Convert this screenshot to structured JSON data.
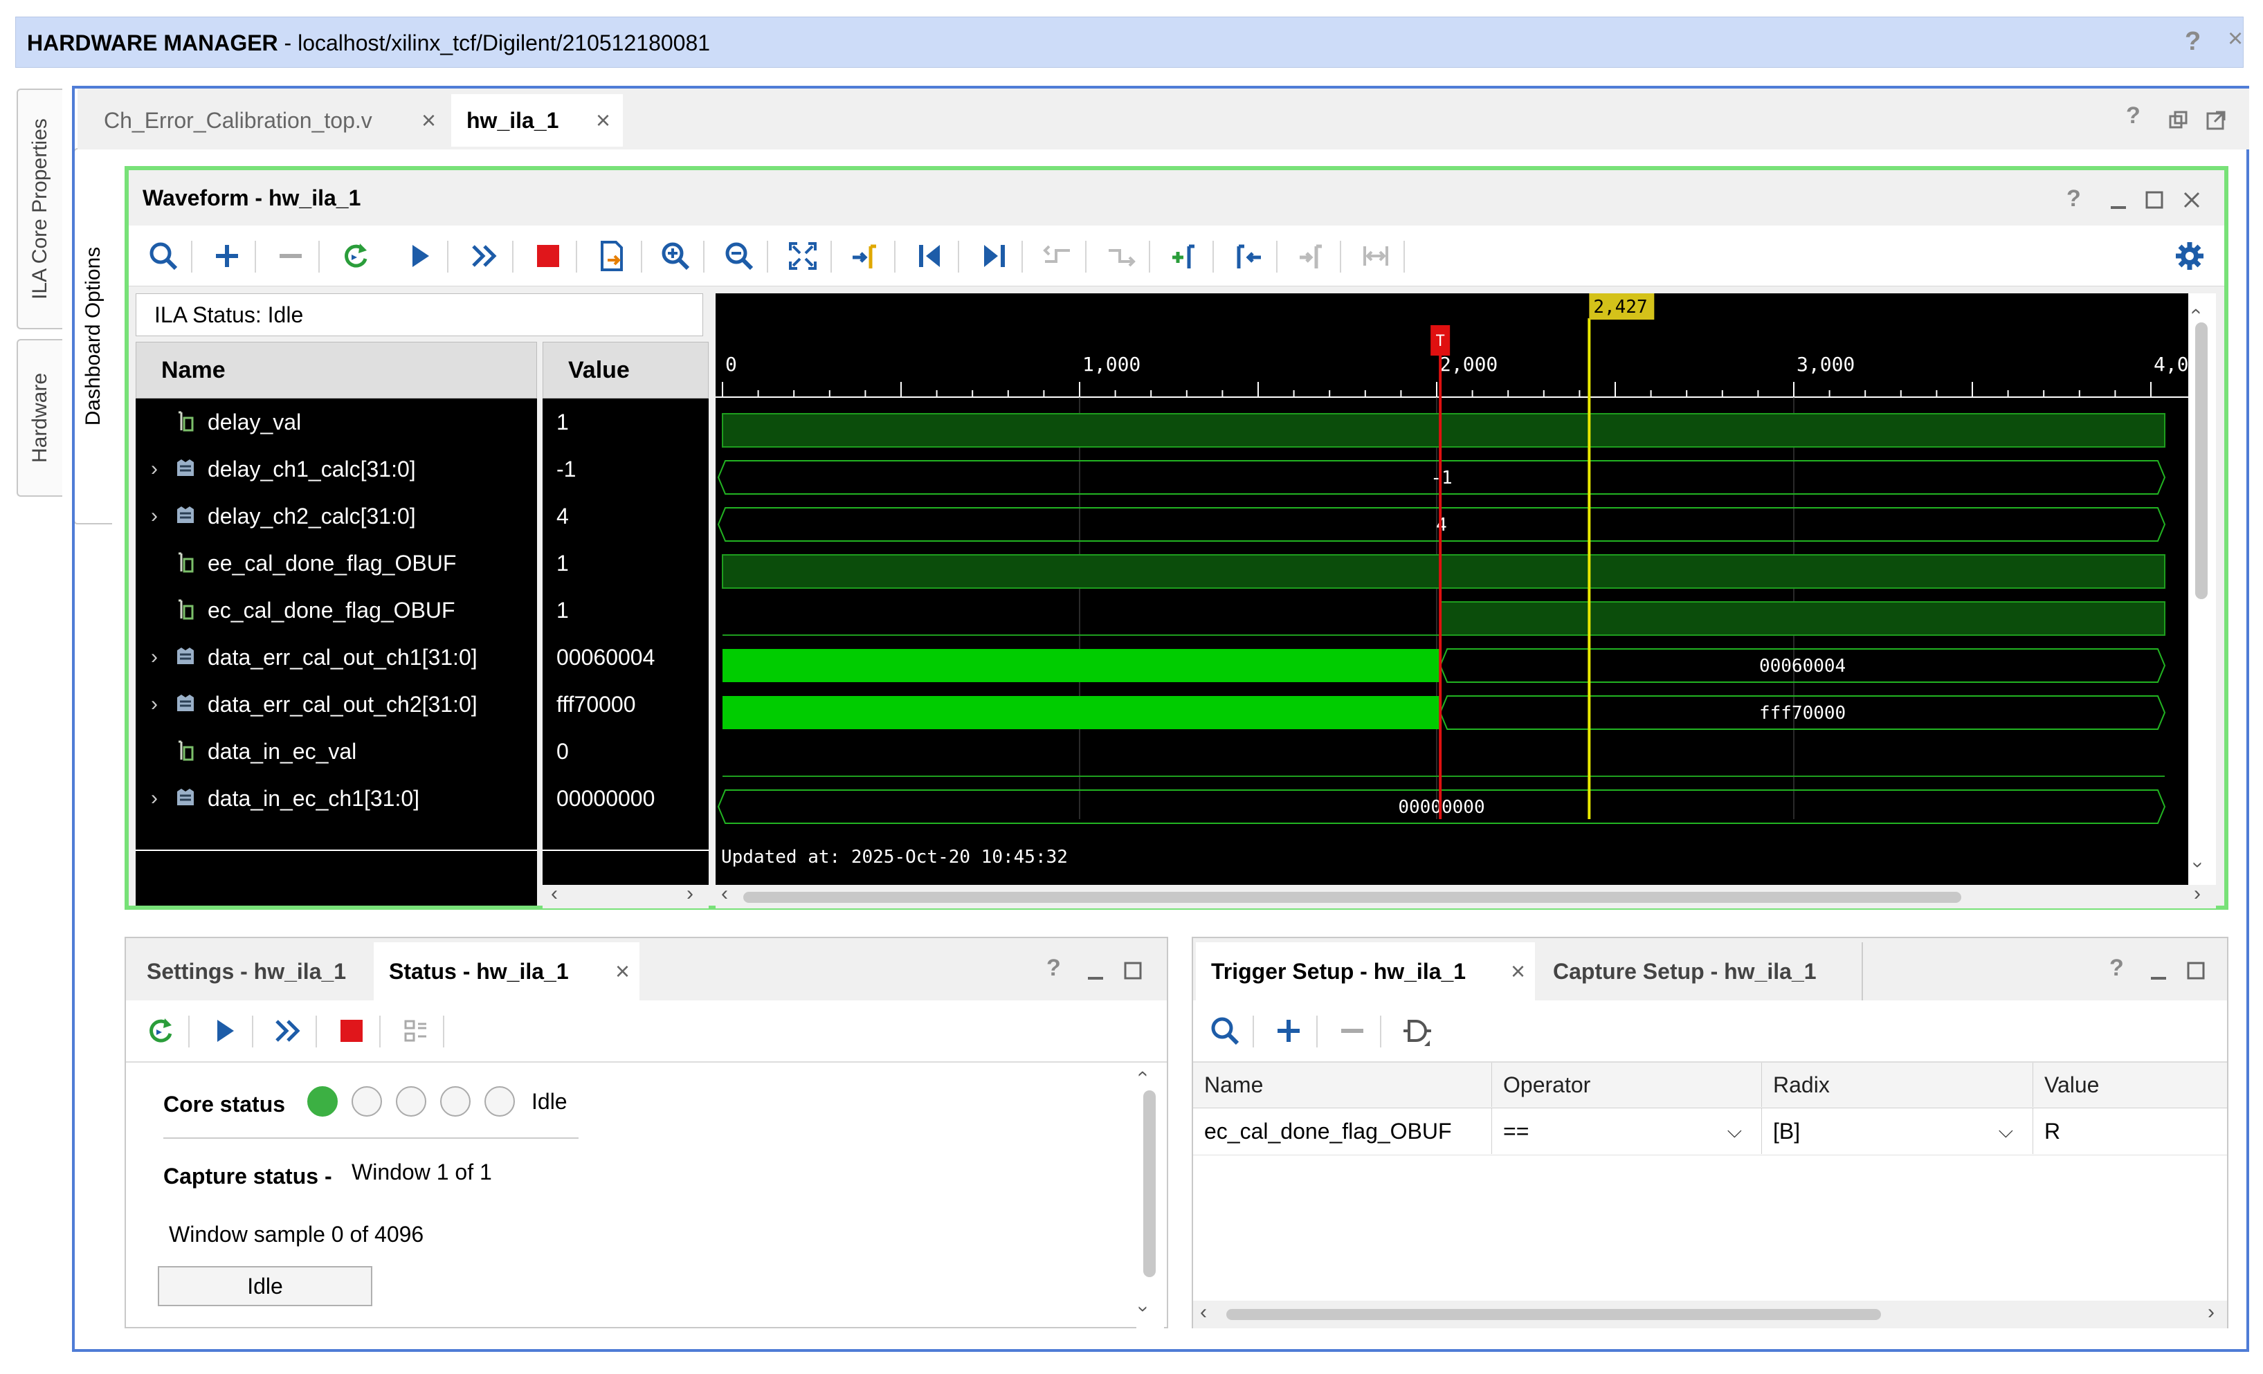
{
  "title_bar": {
    "title": "HARDWARE MANAGER",
    "path": " - localhost/xilinx_tcf/Digilent/210512180081",
    "help": "?",
    "close": "×"
  },
  "side_tabs": {
    "ila_core_properties": "ILA Core Properties",
    "hardware": "Hardware",
    "dashboard_options": "Dashboard Options"
  },
  "editor_tabs": [
    {
      "label": "Ch_Error_Calibration_top.v",
      "active": false
    },
    {
      "label": "hw_ila_1",
      "active": true
    }
  ],
  "waveform": {
    "title": "Waveform - hw_ila_1",
    "ila_status": "ILA Status:  Idle",
    "name_header": "Name",
    "value_header": "Value",
    "updated_at": "Updated at: 2025-Oct-20 10:45:32",
    "time_ruler": {
      "ticks": [
        "0",
        "1,000",
        "2,000",
        "3,000",
        "4,0"
      ],
      "trigger_marker": "T",
      "cursor_label": "2,427",
      "trigger_time": 2010,
      "cursor_time": 2427
    },
    "signals": [
      {
        "name": "delay_val",
        "value": "1",
        "bus": false
      },
      {
        "name": "delay_ch1_calc[31:0]",
        "value": "-1",
        "bus": true,
        "wave_label": "-1"
      },
      {
        "name": "delay_ch2_calc[31:0]",
        "value": "4",
        "bus": true,
        "wave_label": "4"
      },
      {
        "name": "ee_cal_done_flag_OBUF",
        "value": "1",
        "bus": false
      },
      {
        "name": "ec_cal_done_flag_OBUF",
        "value": "1",
        "bus": false
      },
      {
        "name": "data_err_cal_out_ch1[31:0]",
        "value": "00060004",
        "bus": true,
        "wave_label": "00060004"
      },
      {
        "name": "data_err_cal_out_ch2[31:0]",
        "value": "fff70000",
        "bus": true,
        "wave_label": "fff70000"
      },
      {
        "name": "data_in_ec_val",
        "value": "0",
        "bus": false
      },
      {
        "name": "data_in_ec_ch1[31:0]",
        "value": "00000000",
        "bus": true,
        "wave_label": "00000000"
      }
    ],
    "toolbar_icons": [
      "search-icon",
      "add-icon",
      "remove-icon",
      "refresh-icon",
      "run-icon",
      "run-immediate-icon",
      "stop-icon",
      "export-icon",
      "zoom-in-icon",
      "zoom-out-icon",
      "zoom-fit-icon",
      "goto-cursor-icon",
      "goto-start-icon",
      "goto-end-icon",
      "prev-transition-icon",
      "next-transition-icon",
      "add-marker-icon",
      "prev-marker-icon",
      "next-marker-icon",
      "swap-cursors-icon",
      "settings-gear-icon"
    ]
  },
  "status_panel": {
    "tabs": [
      {
        "label": "Settings - hw_ila_1",
        "active": false
      },
      {
        "label": "Status - hw_ila_1",
        "active": true
      }
    ],
    "core_status_label": "Core status",
    "core_status_value": "Idle",
    "capture_status_label": "Capture status -",
    "capture_status_value": "Window 1 of 1",
    "window_sample": "Window sample 0 of 4096",
    "idle_button": "Idle",
    "colors": {
      "active": "#3cb043",
      "inactive": "#f5f5f5"
    }
  },
  "trigger_panel": {
    "tabs": [
      {
        "label": "Trigger Setup - hw_ila_1",
        "active": true
      },
      {
        "label": "Capture Setup - hw_ila_1",
        "active": false
      }
    ],
    "columns": [
      "Name",
      "Operator",
      "Radix",
      "Value"
    ],
    "rows": [
      {
        "name": "ec_cal_done_flag_OBUF",
        "operator": "==",
        "radix": "[B]",
        "value": "R"
      }
    ]
  },
  "colors": {
    "title_bar": "#cddcf8",
    "focus_border": "#78e178",
    "outer_border": "#4f7cd6",
    "wave_green": "#00cc00",
    "wave_dark": "#0b4d0b",
    "trigger_line": "#e01010",
    "cursor_line": "#e8e800"
  }
}
